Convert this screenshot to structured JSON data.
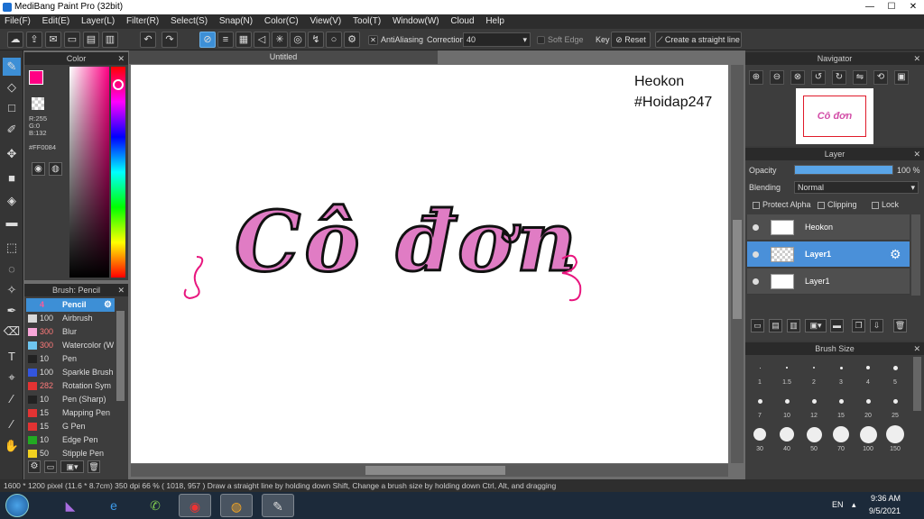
{
  "app": {
    "title": "MediBang Paint Pro (32bit)"
  },
  "menu": [
    "File(F)",
    "Edit(E)",
    "Layer(L)",
    "Filter(R)",
    "Select(S)",
    "Snap(N)",
    "Color(C)",
    "View(V)",
    "Tool(T)",
    "Window(W)",
    "Cloud",
    "Help"
  ],
  "toolbar": {
    "antialiasing": "AntiAliasing",
    "correction_label": "Correction",
    "correction_value": "40",
    "soft_edge": "Soft Edge",
    "key": "Key",
    "reset": "Reset",
    "straight_line": "Create a straight line"
  },
  "color_panel": {
    "title": "Color",
    "r": "R:255",
    "g": "G:0",
    "b": "B:132",
    "hex": "#FF0084",
    "fg_color": "#ff0084"
  },
  "brush_panel": {
    "title": "Brush: Pencil",
    "items": [
      {
        "size": "4",
        "name": "Pencil",
        "color": "#3d8fd6"
      },
      {
        "size": "100",
        "name": "Airbrush",
        "color": "#d8d8d8"
      },
      {
        "size": "300",
        "name": "Blur",
        "color": "#f7a6d8"
      },
      {
        "size": "300",
        "name": "Watercolor (W",
        "color": "#6ec6f0"
      },
      {
        "size": "10",
        "name": "Pen",
        "color": "#222222"
      },
      {
        "size": "100",
        "name": "Sparkle Brush",
        "color": "#3355dd"
      },
      {
        "size": "282",
        "name": "Rotation Sym",
        "color": "#e33333"
      },
      {
        "size": "10",
        "name": "Pen (Sharp)",
        "color": "#222222"
      },
      {
        "size": "15",
        "name": "Mapping Pen",
        "color": "#e33333"
      },
      {
        "size": "15",
        "name": "G Pen",
        "color": "#e33333"
      },
      {
        "size": "10",
        "name": "Edge Pen",
        "color": "#22aa22"
      },
      {
        "size": "50",
        "name": "Stipple Pen",
        "color": "#f0d020"
      }
    ]
  },
  "canvas": {
    "tab": "Untitled",
    "watermark_1": "Heokon",
    "watermark_2": "#Hoidap247",
    "drawn_text": "Cô đơn"
  },
  "navigator": {
    "title": "Navigator",
    "thumb_text": "Cô đơn"
  },
  "layer_panel": {
    "title": "Layer",
    "opacity_label": "Opacity",
    "opacity_value": "100 %",
    "opacity_fraction": 1.0,
    "blending_label": "Blending",
    "blending_value": "Normal",
    "protect_alpha": "Protect Alpha",
    "clipping": "Clipping",
    "lock": "Lock",
    "layers": [
      {
        "name": "Heokon",
        "selected": false
      },
      {
        "name": "Layer1",
        "selected": true
      },
      {
        "name": "Layer1",
        "selected": false
      }
    ]
  },
  "brush_size": {
    "title": "Brush Size",
    "sizes": [
      "1",
      "1.5",
      "2",
      "3",
      "4",
      "5",
      "7",
      "10",
      "12",
      "15",
      "20",
      "25",
      "30",
      "40",
      "50",
      "70",
      "100",
      "150"
    ]
  },
  "status": {
    "text": "1600 * 1200 pixel   (11.6 * 8.7cm)   350 dpi   66 %    ( 1018, 957 )   Draw a straight line by holding down Shift, Change a brush size by holding down Ctrl, Alt, and dragging"
  },
  "taskbar": {
    "lang": "EN",
    "time": "9:36 AM",
    "date": "9/5/2021"
  }
}
